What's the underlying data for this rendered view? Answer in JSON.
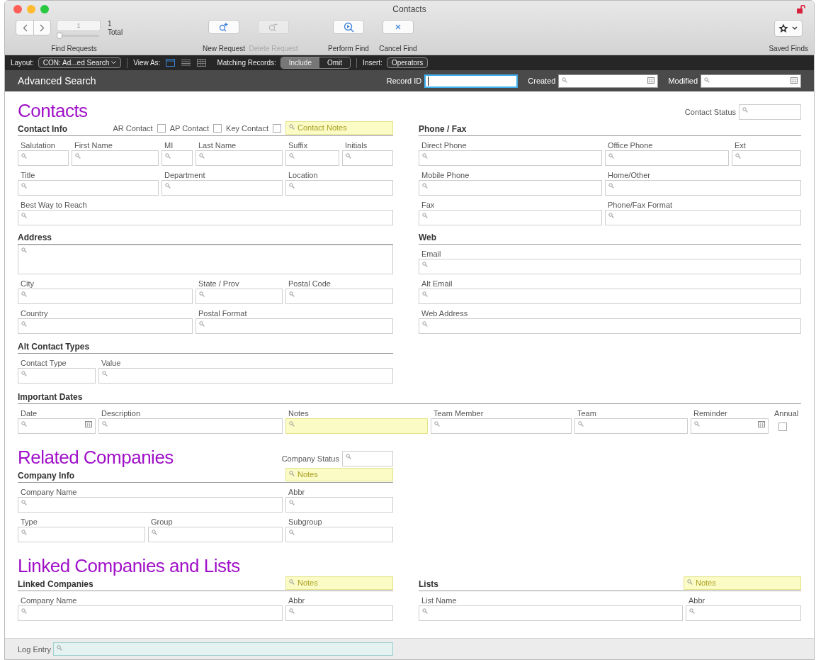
{
  "window": {
    "title": "Contacts"
  },
  "toolbar": {
    "find_requests": {
      "current": "1",
      "count": "1",
      "total": "Total",
      "label": "Find Requests",
      "level": 0
    },
    "buttons": [
      {
        "kind": "new",
        "label": "New Request",
        "disabled": false
      },
      {
        "kind": "delete",
        "label": "Delete Request",
        "disabled": true
      },
      {
        "kind": "perform",
        "label": "Perform Find",
        "disabled": false
      },
      {
        "kind": "cancel",
        "label": "Cancel Find",
        "disabled": false
      }
    ],
    "saved_finds": {
      "label": "Saved Finds"
    }
  },
  "layout_bar": {
    "layout_label": "Layout:",
    "layout_value": "CON: Ad...ed Search",
    "view_as_label": "View As:",
    "views": [
      {
        "kind": "form",
        "selected": true
      },
      {
        "kind": "list",
        "selected": false
      },
      {
        "kind": "table",
        "selected": false
      }
    ],
    "matching_label": "Matching Records:",
    "matching": [
      {
        "label": "Include",
        "selected": true
      },
      {
        "label": "Omit",
        "selected": false
      }
    ],
    "insert_label": "Insert:",
    "insert_button": "Operators"
  },
  "header": {
    "title": "Advanced Search",
    "fields": [
      {
        "label": "Record ID",
        "kind": "text",
        "focused": true
      },
      {
        "label": "Created",
        "kind": "date",
        "focused": false
      },
      {
        "label": "Modified",
        "kind": "date",
        "focused": false
      }
    ]
  },
  "contacts": {
    "title": "Contacts",
    "status": {
      "label": "Contact Status"
    },
    "contact_info": {
      "heading": "Contact Info",
      "extras": [
        {
          "kind": "checkbox",
          "label": "AR Contact",
          "checked": false
        },
        {
          "kind": "checkbox",
          "label": "AP Contact",
          "checked": false
        },
        {
          "kind": "checkbox",
          "label": "Key Contact",
          "checked": false
        },
        {
          "kind": "notes",
          "placeholder": "Contact Notes"
        }
      ],
      "lines": [
        {
          "fields": [
            {
              "label": "Salutation",
              "kind": "search"
            },
            {
              "label": "First Name",
              "kind": "search"
            },
            {
              "label": "MI",
              "kind": "search"
            },
            {
              "label": "Last Name",
              "kind": "search"
            },
            {
              "label": "Suffix",
              "kind": "search"
            },
            {
              "label": "Initials",
              "kind": "search"
            }
          ]
        },
        {
          "fields": [
            {
              "label": "Title",
              "kind": "search"
            },
            {
              "label": "Department",
              "kind": "search"
            },
            {
              "label": "Location",
              "kind": "search"
            }
          ]
        },
        {
          "fields": [
            {
              "label": "Best Way to Reach",
              "kind": "search"
            }
          ]
        }
      ]
    },
    "address": {
      "heading": "Address",
      "lines": [
        {
          "fields": [
            {
              "kind": "multiline"
            }
          ]
        },
        {
          "fields": [
            {
              "label": "City",
              "kind": "search"
            },
            {
              "label": "State / Prov",
              "kind": "search"
            },
            {
              "label": "Postal Code",
              "kind": "search"
            }
          ]
        },
        {
          "fields": [
            {
              "label": "Country",
              "kind": "search"
            },
            {
              "label": "Postal Format",
              "kind": "search"
            }
          ]
        }
      ]
    },
    "alt_contact_types": {
      "heading": "Alt Contact Types",
      "lines": [
        {
          "fields": [
            {
              "label": "Contact Type",
              "kind": "search"
            },
            {
              "label": "Value",
              "kind": "search"
            }
          ]
        }
      ]
    },
    "phone_fax": {
      "heading": "Phone / Fax",
      "lines": [
        {
          "fields": [
            {
              "label": "Direct Phone",
              "kind": "search"
            },
            {
              "label": "Office Phone",
              "kind": "search"
            },
            {
              "label": "Ext",
              "kind": "search"
            }
          ]
        },
        {
          "fields": [
            {
              "label": "Mobile Phone",
              "kind": "search"
            },
            {
              "label": "Home/Other",
              "kind": "search"
            }
          ]
        },
        {
          "fields": [
            {
              "label": "Fax",
              "kind": "search"
            },
            {
              "label": "Phone/Fax Format",
              "kind": "search"
            }
          ]
        }
      ]
    },
    "web": {
      "heading": "Web",
      "lines": [
        {
          "fields": [
            {
              "label": "Email",
              "kind": "search"
            }
          ]
        },
        {
          "fields": [
            {
              "label": "Alt Email",
              "kind": "search"
            }
          ]
        },
        {
          "fields": [
            {
              "label": "Web Address",
              "kind": "search"
            }
          ]
        }
      ]
    }
  },
  "important_dates": {
    "heading": "Important Dates",
    "lines": [
      {
        "fields": [
          {
            "label": "Date",
            "kind": "date"
          },
          {
            "label": "Description",
            "kind": "search"
          },
          {
            "label": "Notes",
            "kind": "notes"
          },
          {
            "label": "Team Member",
            "kind": "search"
          },
          {
            "label": "Team",
            "kind": "search"
          },
          {
            "label": "Reminder",
            "kind": "date"
          },
          {
            "label": "Annual",
            "kind": "checkbox",
            "checked": false
          }
        ]
      }
    ]
  },
  "related_companies": {
    "title": "Related Companies",
    "status": {
      "label": "Company Status"
    },
    "company_info": {
      "heading": "Company Info",
      "extras": [
        {
          "kind": "notes",
          "placeholder": "Notes"
        }
      ],
      "lines": [
        {
          "fields": [
            {
              "label": "Company Name",
              "kind": "search"
            },
            {
              "label": "Abbr",
              "kind": "search"
            }
          ]
        },
        {
          "fields": [
            {
              "label": "Type",
              "kind": "search"
            },
            {
              "label": "Group",
              "kind": "search"
            },
            {
              "label": "Subgroup",
              "kind": "search"
            }
          ]
        }
      ]
    }
  },
  "linked": {
    "title": "Linked Companies and Lists",
    "linked_companies": {
      "heading": "Linked Companies",
      "extras": [
        {
          "kind": "notes",
          "placeholder": "Notes"
        }
      ],
      "lines": [
        {
          "fields": [
            {
              "label": "Company Name",
              "kind": "search"
            },
            {
              "label": "Abbr",
              "kind": "search"
            }
          ]
        }
      ]
    },
    "lists": {
      "heading": "Lists",
      "extras": [
        {
          "kind": "notes",
          "placeholder": "Notes"
        }
      ],
      "lines": [
        {
          "fields": [
            {
              "label": "List Name",
              "kind": "search"
            },
            {
              "label": "Abbr",
              "kind": "search"
            }
          ]
        }
      ]
    }
  },
  "log_entry": {
    "label": "Log Entry"
  }
}
